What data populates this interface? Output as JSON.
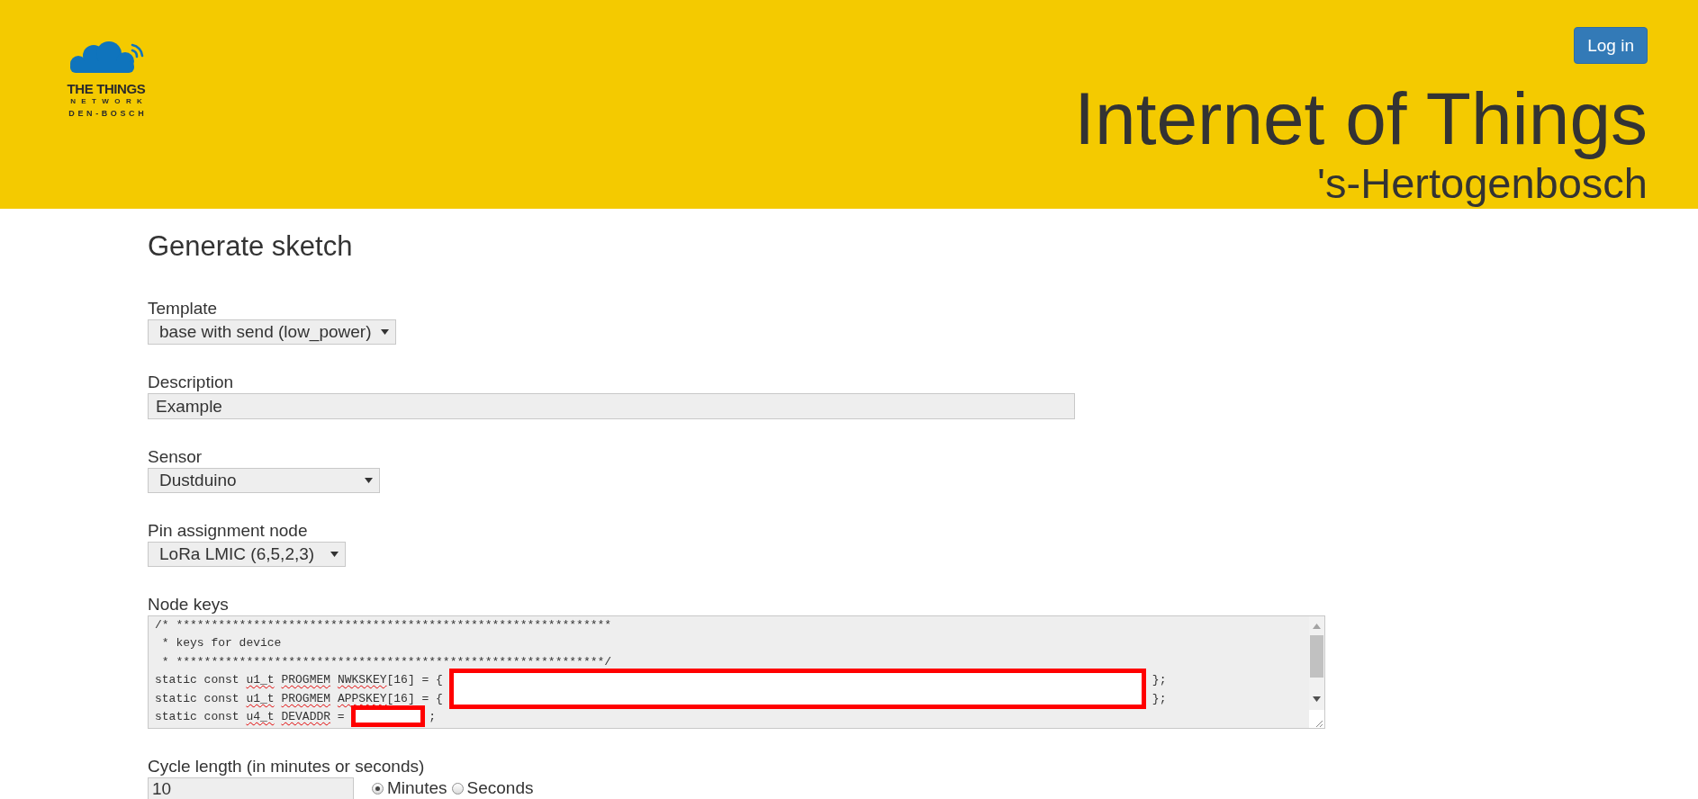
{
  "header": {
    "logo": {
      "lines": [
        "THE THINGS",
        "NETWORK",
        "DEN-BOSCH"
      ]
    },
    "login_button": "Log in",
    "title": "Internet of Things",
    "subtitle": "'s-Hertogenbosch"
  },
  "page": {
    "heading": "Generate sketch"
  },
  "fields": [
    {
      "kind": "select",
      "label": "Template",
      "value": "base with send (low_power)"
    },
    {
      "kind": "text",
      "label": "Description",
      "value": "Example"
    },
    {
      "kind": "select",
      "label": "Sensor",
      "value": "Dustduino"
    },
    {
      "kind": "select",
      "label": "Pin assignment node",
      "value": "LoRa LMIC (6,5,2,3)"
    },
    {
      "kind": "code",
      "label": "Node keys",
      "lines": [
        {
          "segments": [
            {
              "text": "/* **************************************************************",
              "misspelled": false
            }
          ]
        },
        {
          "segments": [
            {
              "text": " * keys for device",
              "misspelled": false
            }
          ]
        },
        {
          "segments": [
            {
              "text": " * *************************************************************/",
              "misspelled": false
            }
          ]
        },
        {
          "kind": "key",
          "segments": [
            {
              "text": "static const ",
              "misspelled": false
            },
            {
              "text": "u1_t ",
              "misspelled": true
            },
            {
              "text": "PROGMEM ",
              "misspelled": true
            },
            {
              "text": "NWKSKEY",
              "misspelled": true
            },
            {
              "text": "[16] = {",
              "misspelled": false
            }
          ],
          "suffix": "};"
        },
        {
          "kind": "key",
          "segments": [
            {
              "text": "static const ",
              "misspelled": false
            },
            {
              "text": "u1_t ",
              "misspelled": true
            },
            {
              "text": "PROGMEM ",
              "misspelled": true
            },
            {
              "text": "APPSKEY",
              "misspelled": true
            },
            {
              "text": "[16] = {",
              "misspelled": false
            }
          ],
          "suffix": "};"
        },
        {
          "kind": "address",
          "segments": [
            {
              "text": "static const ",
              "misspelled": false
            },
            {
              "text": "u4_t ",
              "misspelled": true
            },
            {
              "text": "DEVADDR",
              "misspelled": true
            },
            {
              "text": " = ",
              "misspelled": false
            }
          ],
          "suffix": ";"
        }
      ]
    },
    {
      "kind": "number_with_units",
      "label": "Cycle length (in minutes or seconds)",
      "value": "10",
      "options": [
        {
          "label": "Minutes",
          "selected": true
        },
        {
          "label": "Seconds",
          "selected": false
        }
      ]
    }
  ]
}
